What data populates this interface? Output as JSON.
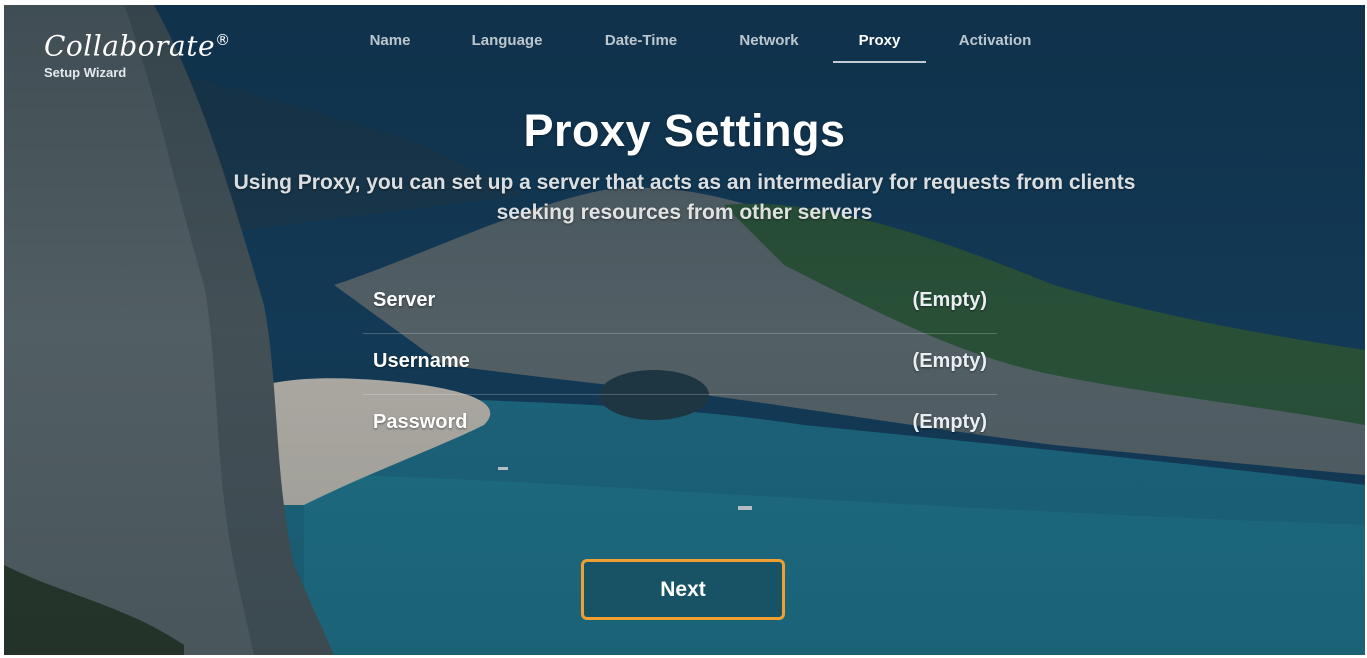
{
  "brand": {
    "logo_text": "Collaborate",
    "registered_mark": "®",
    "subtitle": "Setup Wizard"
  },
  "nav": {
    "tabs": [
      {
        "label": "Name",
        "active": false
      },
      {
        "label": "Language",
        "active": false
      },
      {
        "label": "Date-Time",
        "active": false
      },
      {
        "label": "Network",
        "active": false
      },
      {
        "label": "Proxy",
        "active": true
      },
      {
        "label": "Activation",
        "active": false
      }
    ]
  },
  "page": {
    "title": "Proxy Settings",
    "description": "Using Proxy, you can set up a server that acts as an intermediary for requests from clients seeking resources from other servers"
  },
  "settings": [
    {
      "label": "Server",
      "value": "(Empty)"
    },
    {
      "label": "Username",
      "value": "(Empty)"
    },
    {
      "label": "Password",
      "value": "(Empty)"
    }
  ],
  "actions": {
    "next_label": "Next"
  },
  "colors": {
    "accent_border": "#f0a030",
    "text": "#ffffff"
  }
}
